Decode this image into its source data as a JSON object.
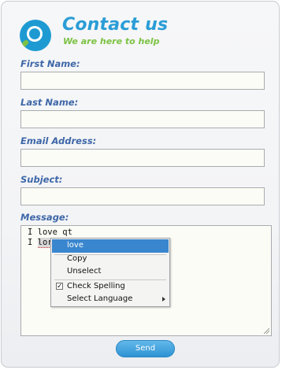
{
  "header": {
    "title": "Contact us",
    "tagline": "We are here to help",
    "logo_icon": "magnifier-icon"
  },
  "form": {
    "first_name_label": "First Name:",
    "first_name_value": "",
    "last_name_label": "Last Name:",
    "last_name_value": "",
    "email_label": "Email Address:",
    "email_value": "",
    "subject_label": "Subject:",
    "subject_value": "",
    "message_label": "Message:",
    "message_lines": [
      "I love qt",
      "I lorr qt"
    ],
    "misspelled_word": "lorr",
    "send_label": "Send"
  },
  "context_menu": {
    "suggestion": "love",
    "items": [
      "Copy",
      "Unselect"
    ],
    "check_spelling_label": "Check Spelling",
    "check_spelling_checked": true,
    "select_language_label": "Select Language"
  },
  "colors": {
    "title": "#2a9dd6",
    "tagline": "#7cc243",
    "label": "#3e67a8",
    "menu_highlight": "#3a86ce",
    "button": "#3d9fdc"
  }
}
